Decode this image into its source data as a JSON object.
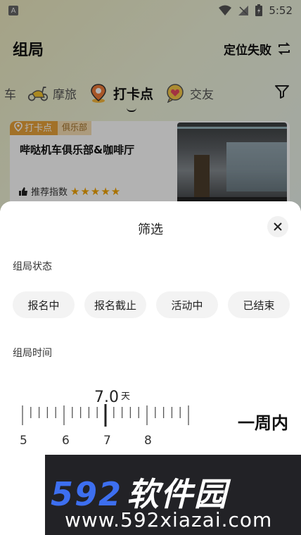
{
  "status_bar": {
    "time": "5:52",
    "notif_icon": "A"
  },
  "header": {
    "title": "组局",
    "location_label": "定位失败"
  },
  "tabs": [
    {
      "label": "车",
      "icon": "car-icon"
    },
    {
      "label": "摩旅",
      "icon": "scooter-icon"
    },
    {
      "label": "打卡点",
      "icon": "location-pin-icon",
      "active": true
    },
    {
      "label": "交友",
      "icon": "heart-bubble-icon"
    }
  ],
  "card": {
    "badge": "打卡点",
    "category": "俱乐部",
    "name": "哔哒机车俱乐部&咖啡厅",
    "recommend_label": "推荐指数",
    "rating": 5,
    "stars": "★★★★★"
  },
  "filter_sheet": {
    "title": "筛选",
    "status_label": "组局状态",
    "status_options": [
      "报名中",
      "报名截止",
      "活动中",
      "已结束"
    ],
    "time_label": "组局时间",
    "ruler": {
      "value": "7.0",
      "unit": "天",
      "tick_labels": [
        "5",
        "6",
        "7",
        "8"
      ],
      "summary": "一周内"
    }
  },
  "watermark": {
    "brand_number": "592",
    "brand_text": "软件园",
    "url": "www.592xiazai.com"
  },
  "colors": {
    "badge_orange": "#e8a33a",
    "star_gold": "#f2a400",
    "watermark_blue": "#3d6ff0"
  }
}
